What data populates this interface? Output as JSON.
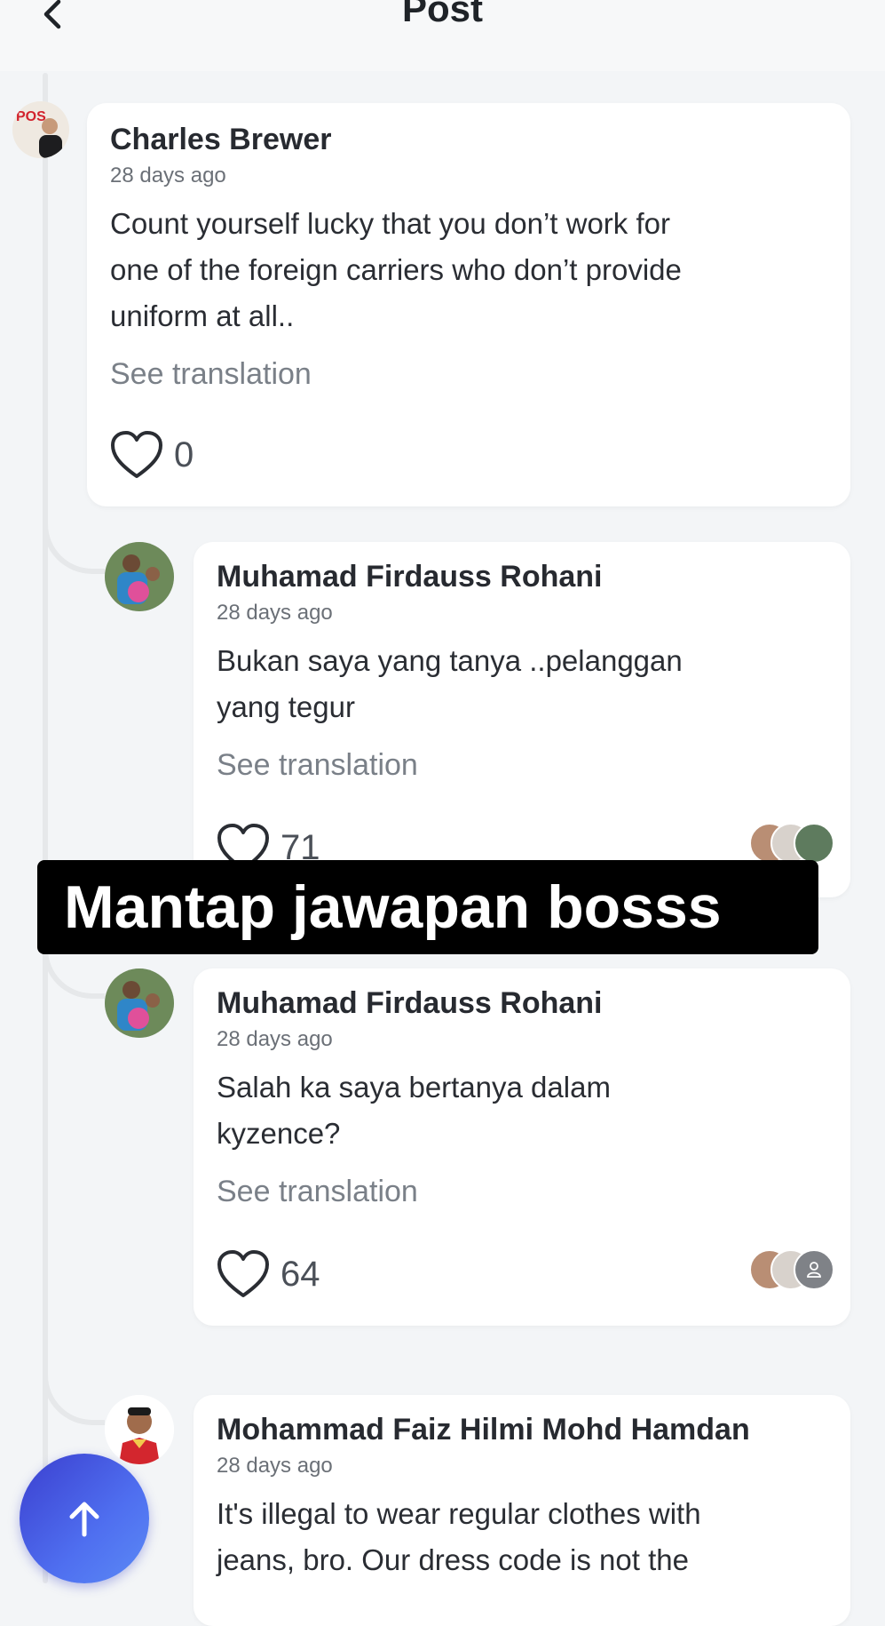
{
  "header": {
    "title": "Post"
  },
  "comments": [
    {
      "author": "Charles Brewer",
      "time": "28 days ago",
      "lines": [
        "Count yourself lucky that you don’t work for",
        "one of the foreign carriers who don’t provide",
        "uniform at all.."
      ],
      "translate": "See translation",
      "likes": "0"
    },
    {
      "author": "Muhamad Firdauss Rohani",
      "time": "28 days ago",
      "lines": [
        "Bukan saya yang tanya ..pelanggan",
        "yang tegur"
      ],
      "translate": "See translation",
      "likes": "71"
    },
    {
      "author": "Muhamad Firdauss Rohani",
      "time": "28 days ago",
      "lines": [
        "Salah ka saya bertanya dalam",
        "kyzence?"
      ],
      "translate": "See translation",
      "likes": "64"
    },
    {
      "author": "Mohammad Faiz Hilmi Mohd Hamdan",
      "time": "28 days ago",
      "lines": [
        "It's illegal to wear regular clothes with",
        "jeans, bro. Our dress code is not the"
      ]
    }
  ],
  "overlay": {
    "caption": "Mantap jawapan bosss"
  },
  "icons": {
    "back": "chevron-left-icon",
    "like": "heart-icon",
    "scroll_top": "arrow-up-icon"
  },
  "colors": {
    "accent": "#4f6ff0",
    "background": "#f3f5f7"
  }
}
